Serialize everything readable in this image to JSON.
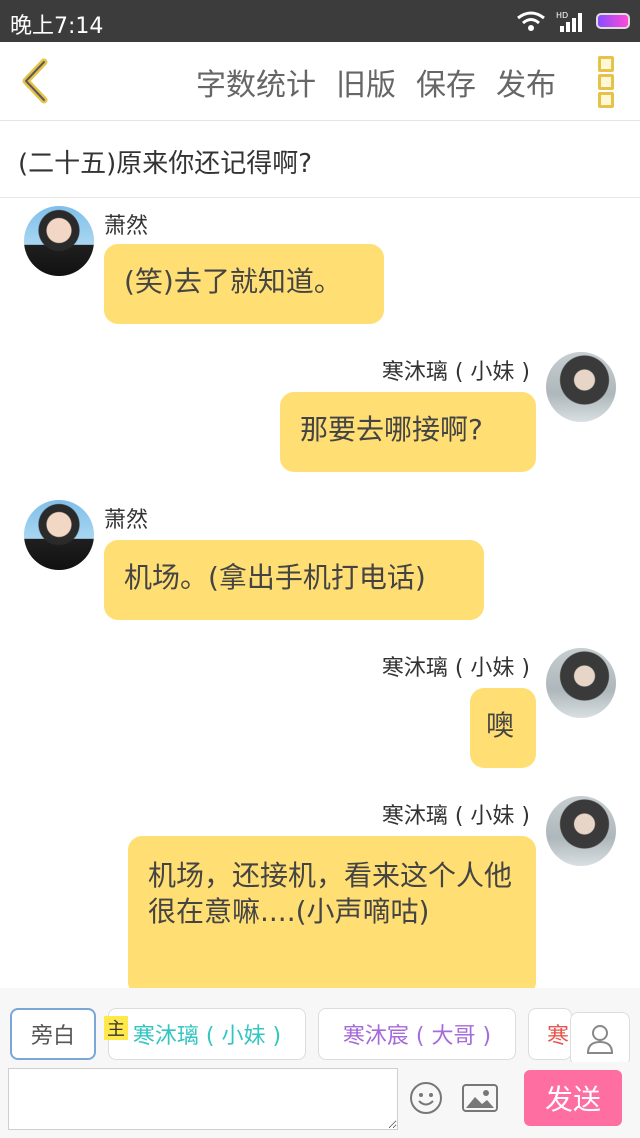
{
  "status_bar": {
    "time": "晚上7:14"
  },
  "header": {
    "actions": [
      "字数统计",
      "旧版",
      "保存",
      "发布"
    ]
  },
  "chapter": {
    "title": "(二十五)原来你还记得啊?"
  },
  "messages": [
    {
      "speaker": "萧然",
      "side": "left",
      "text": "(笑)去了就知道。"
    },
    {
      "speaker": "寒沐璃 ( 小妹 )",
      "side": "right",
      "text": "那要去哪接啊?"
    },
    {
      "speaker": "萧然",
      "side": "left",
      "text": "机场。(拿出手机打电话)"
    },
    {
      "speaker": "寒沐璃 ( 小妹 )",
      "side": "right",
      "text": "噢"
    },
    {
      "speaker": "寒沐璃 ( 小妹 )",
      "side": "right",
      "text": "机场，还接机，看来这个人他很在意嘛....(小声嘀咕)"
    }
  ],
  "roles": {
    "narration": "旁白",
    "main_badge": "主",
    "items": [
      {
        "label": "寒沐璃 ( 小妹 )",
        "color": "#33c6c1"
      },
      {
        "label": "寒沐宸 ( 大哥 )",
        "color": "#a56bd8"
      },
      {
        "label": "寒",
        "color": "#e8574f"
      }
    ]
  },
  "composer": {
    "value": "",
    "send_label": "发送"
  },
  "colors": {
    "bubble": "#ffde73",
    "accent_yellow": "#e6c24a",
    "send": "#ff6ea0"
  }
}
